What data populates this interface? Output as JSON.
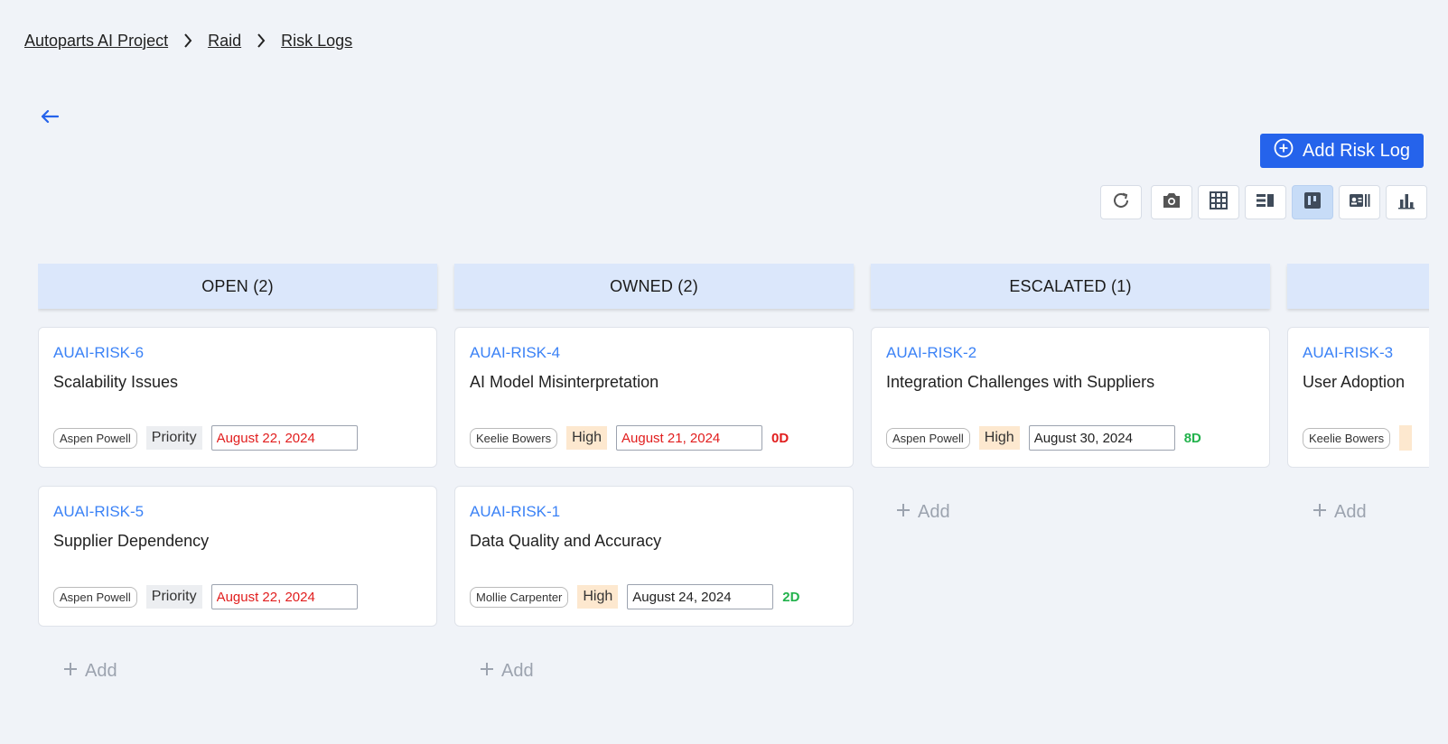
{
  "breadcrumb": [
    "Autoparts AI Project",
    "Raid",
    "Risk Logs"
  ],
  "add_button_label": "Add Risk Log",
  "toolbar_icons": [
    "refresh-icon",
    "camera-icon",
    "grid-icon",
    "list-detail-icon",
    "kanban-icon",
    "card-view-icon",
    "bar-chart-icon"
  ],
  "active_view": "kanban",
  "add_label": "Add",
  "columns": [
    {
      "title": "OPEN (2)",
      "cards": [
        {
          "key": "AUAI-RISK-6",
          "title": "Scalability Issues",
          "assignee": "Aspen Powell",
          "priority": "Priority",
          "date": "August 22, 2024",
          "days": ""
        },
        {
          "key": "AUAI-RISK-5",
          "title": "Supplier Dependency",
          "assignee": "Aspen Powell",
          "priority": "Priority",
          "date": "August 22, 2024",
          "days": ""
        }
      ]
    },
    {
      "title": "OWNED (2)",
      "cards": [
        {
          "key": "AUAI-RISK-4",
          "title": "AI Model Misinterpretation",
          "assignee": "Keelie Bowers",
          "priority": "High",
          "date": "August 21, 2024",
          "days": "0D"
        },
        {
          "key": "AUAI-RISK-1",
          "title": "Data Quality and Accuracy",
          "assignee": "Mollie Carpenter",
          "priority": "High",
          "date": "August 24, 2024",
          "days": "2D"
        }
      ]
    },
    {
      "title": "ESCALATED (1)",
      "cards": [
        {
          "key": "AUAI-RISK-2",
          "title": "Integration Challenges with Suppliers",
          "assignee": "Aspen Powell",
          "priority": "High",
          "date": "August 30, 2024",
          "days": "8D"
        }
      ]
    },
    {
      "title": "",
      "cards": [
        {
          "key": "AUAI-RISK-3",
          "title": "User Adoption",
          "assignee": "Keelie Bowers",
          "priority": "",
          "date": "",
          "days": ""
        }
      ]
    }
  ],
  "colors": {
    "accent": "#2563eb",
    "overdue": "#e11d1d",
    "ontime": "#22b24c",
    "column_header": "#dbe7fb"
  }
}
